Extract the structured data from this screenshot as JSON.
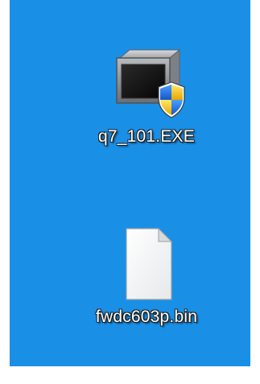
{
  "desktop": {
    "background_color": "#1a8fe6",
    "icons": [
      {
        "label": "q7_101.EXE",
        "icon": "application-window-uac-shield-icon"
      },
      {
        "label": "fwdc603p.bin",
        "icon": "blank-document-icon"
      }
    ]
  }
}
